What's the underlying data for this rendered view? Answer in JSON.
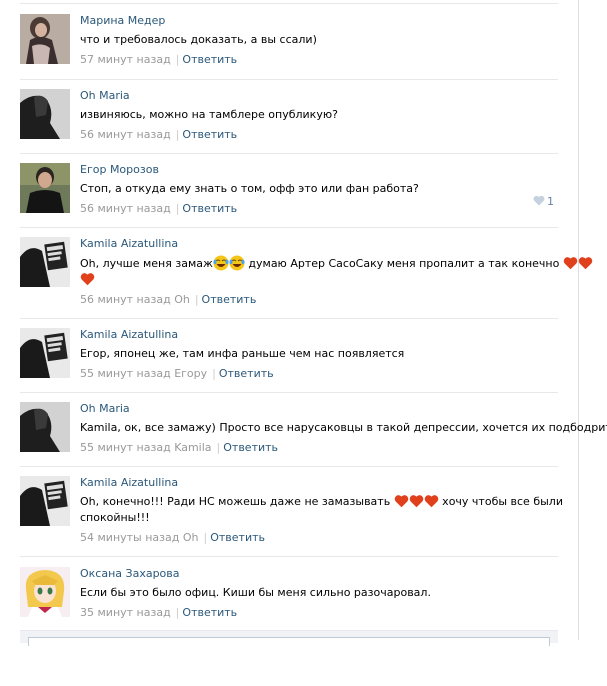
{
  "comments": [
    {
      "author": "Марина Медер",
      "text": "что и требовалось доказать, а вы ссали)",
      "time": "57 минут назад",
      "to": "",
      "reply": "Ответить"
    },
    {
      "author": "Oh Maria",
      "text": "извиняюсь, можно на тамблере опубликую?",
      "time": "56 минут назад",
      "to": "",
      "reply": "Ответить"
    },
    {
      "author": "Егор Морозов",
      "text": "Стоп, а откуда ему знать о том, офф это или фан работа?",
      "time": "56 минут назад",
      "to": "",
      "reply": "Ответить",
      "likes": "1"
    },
    {
      "author": "Kamila Aizatullina",
      "text_a": "Oh, лучше меня замаж",
      "text_b": " думаю Артер СасоСаку меня пропалит а так конечно",
      "time": "56 минут назад",
      "to": "Oh",
      "reply": "Ответить"
    },
    {
      "author": "Kamila Aizatullina",
      "text": "Егор, японец же, там инфа раньше чем нас появляется",
      "time": "55 минут назад",
      "to": "Егору",
      "reply": "Ответить"
    },
    {
      "author": "Oh Maria",
      "text": "Kamila, ок, все замажу) Просто все нарусаковцы в такой депрессии, хочется их подбодрить)",
      "time": "55 минут назад",
      "to": "Kamila",
      "reply": "Ответить"
    },
    {
      "author": "Kamila Aizatullina",
      "text_a": "Oh, конечно!!! Ради НС можешь даже не замазывать",
      "text_b": " хочу чтобы все были",
      "text_c": "спокойны!!!",
      "time": "54 минуты назад",
      "to": "Oh",
      "reply": "Ответить"
    },
    {
      "author": "Оксана Захарова",
      "text": "Если бы это было офиц. Киши бы меня сильно разочаровал.",
      "time": "35 минут назад",
      "to": "",
      "reply": "Ответить"
    }
  ],
  "icons": {
    "heart": "heart-emoji-icon",
    "laugh": "laughing-emoji-icon",
    "like": "like-heart-icon"
  },
  "colors": {
    "link": "#2b587a",
    "meta": "#999999",
    "heart_emoji": "#e0401c",
    "like_heart": "#c5d1de",
    "separator": "#e7e8ec"
  }
}
